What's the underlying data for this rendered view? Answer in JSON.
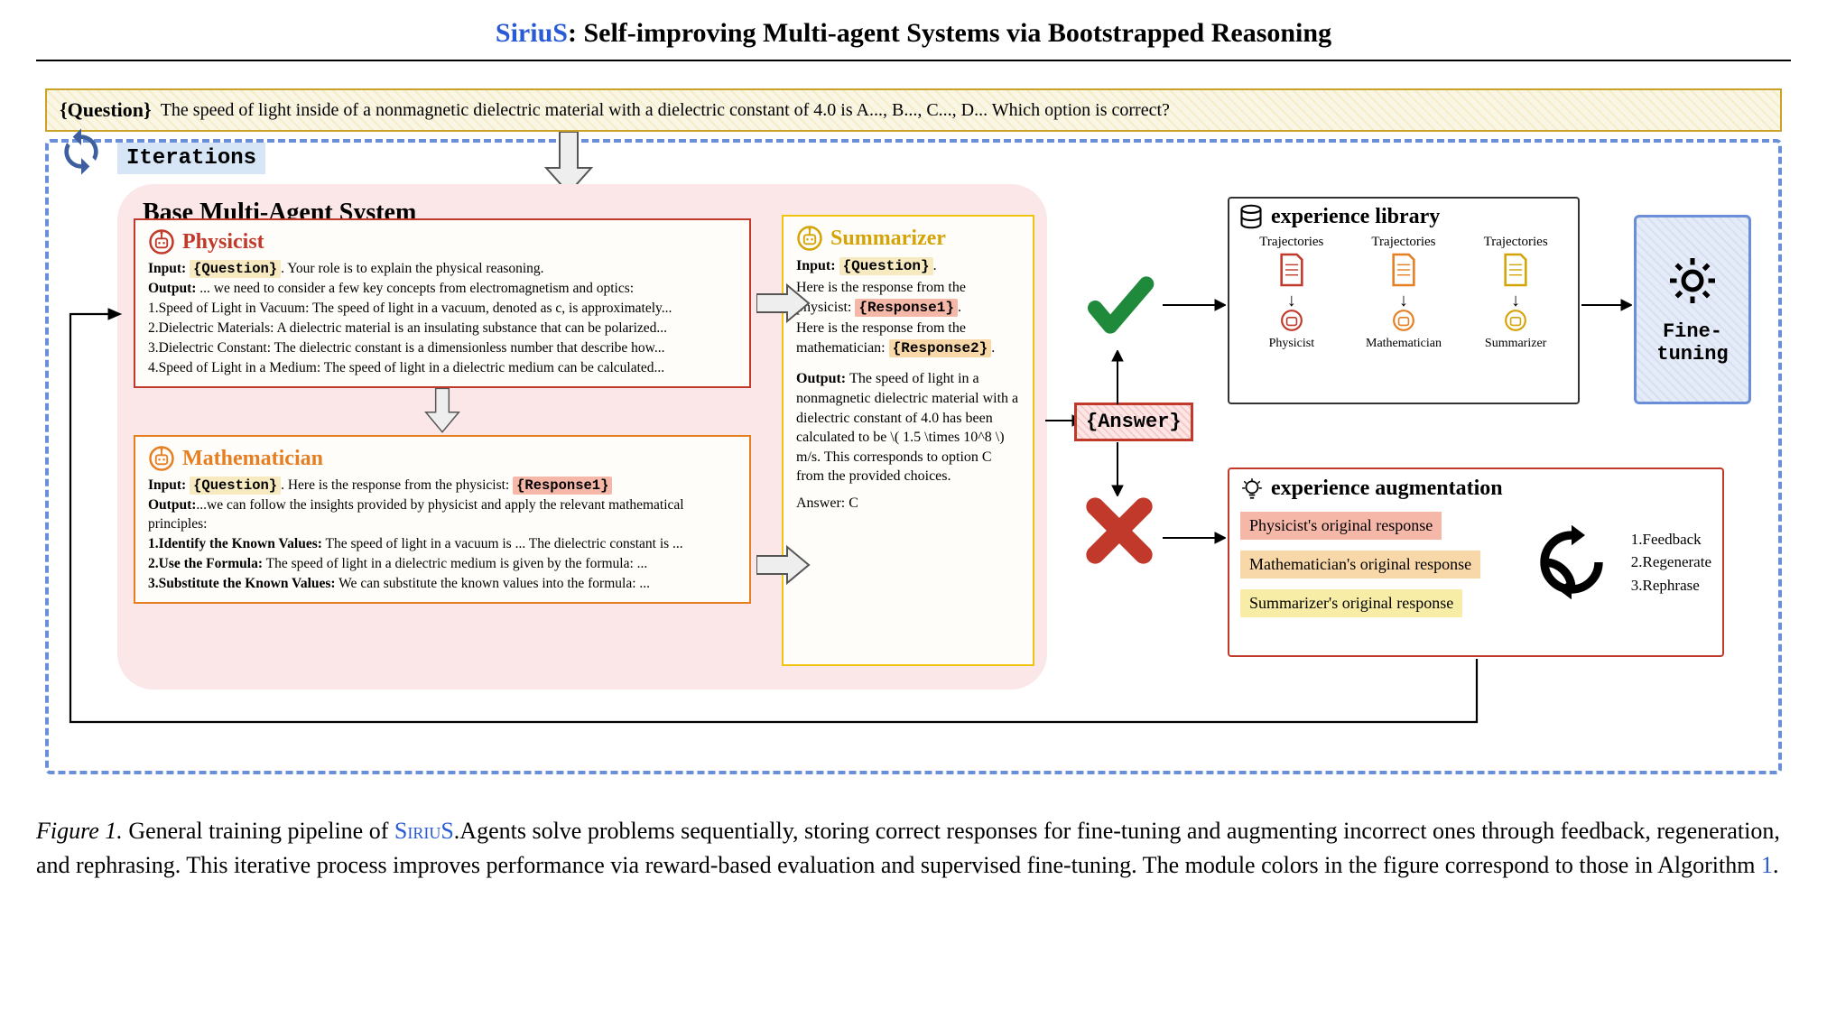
{
  "title": {
    "brand": "SiriuS",
    "rest": ": Self-improving Multi-agent Systems via Bootstrapped Reasoning"
  },
  "question": {
    "label": "{Question}",
    "text": "The speed of light inside of a nonmagnetic dielectric material with a dielectric constant of 4.0 is A..., B..., C..., D... Which option is correct?"
  },
  "iterations_label": "Iterations",
  "system_title": "Base Multi-Agent System",
  "physicist": {
    "name": "Physicist",
    "input_prefix": "Input: ",
    "input_tag": "{Question}",
    "input_rest": ". Your role is to explain the physical reasoning.",
    "output_prefix": "Output: ",
    "output_intro": "... we need to consider a few key concepts from electromagnetism and optics:",
    "lines": [
      "1.Speed of Light in Vacuum: The speed of light in a vacuum, denoted as c, is approximately...",
      "2.Dielectric Materials: A dielectric material is an insulating substance that can be polarized...",
      "3.Dielectric Constant: The dielectric constant is a dimensionless number that describe how...",
      "4.Speed of Light in a Medium: The speed of light in a dielectric medium can be calculated..."
    ]
  },
  "mathematician": {
    "name": "Mathematician",
    "input_prefix": "Input: ",
    "input_tag": "{Question}",
    "input_mid": ". Here is the response from the physicist: ",
    "input_r1": "{Response1}",
    "output_prefix": "Output:",
    "output_intro": "...we can follow the insights provided by physicist and apply the relevant mathematical principles:",
    "lines": [
      {
        "b": "1.Identify the Known Values:",
        "t": " The speed of light in a vacuum is ... The dielectric constant is ..."
      },
      {
        "b": "2.Use the Formula:",
        "t": " The speed of light in a dielectric medium is given by the formula: ..."
      },
      {
        "b": "3.Substitute the Known Values:",
        "t": " We can substitute the known values into the formula: ..."
      }
    ]
  },
  "summarizer": {
    "name": "Summarizer",
    "input_prefix": "Input: ",
    "input_tag": "{Question}",
    "input_line2a": "Here is the response from the physicist: ",
    "input_r1": "{Response1}",
    "input_line3a": "Here is the response from the mathematician: ",
    "input_r2": "{Response2}",
    "output_prefix": "Output: ",
    "output_text": "The speed of light in a nonmagnetic dielectric material with a dielectric constant of 4.0 has been calculated to be \\( 1.5 \\times 10^8 \\) m/s. This corresponds to option C from the provided choices.",
    "answer_line": "Answer: C"
  },
  "answer_tag": "{Answer}",
  "library": {
    "title": "experience library",
    "cols": [
      {
        "traj": "Trajectories",
        "role": "Physicist"
      },
      {
        "traj": "Trajectories",
        "role": "Mathematician"
      },
      {
        "traj": "Trajectories",
        "role": "Summarizer"
      }
    ]
  },
  "augmentation": {
    "title": "experience augmentation",
    "items": [
      "Physicist's original response",
      "Mathematician's original response",
      "Summarizer's original response"
    ],
    "steps": [
      "1.Feedback",
      "2.Regenerate",
      "3.Rephrase"
    ]
  },
  "finetune": "Fine-\ntuning",
  "caption": {
    "figlabel": "Figure 1.",
    "pre": " General training pipeline of ",
    "brand": "SiriuS",
    "post": ".Agents solve problems sequentially, storing correct responses for fine-tuning and augmenting incorrect ones through feedback, regeneration, and rephrasing. This iterative process improves performance via reward-based evaluation and supervised fine-tuning. The module colors in the figure correspond to those in Algorithm ",
    "alg": "1",
    "end": "."
  }
}
